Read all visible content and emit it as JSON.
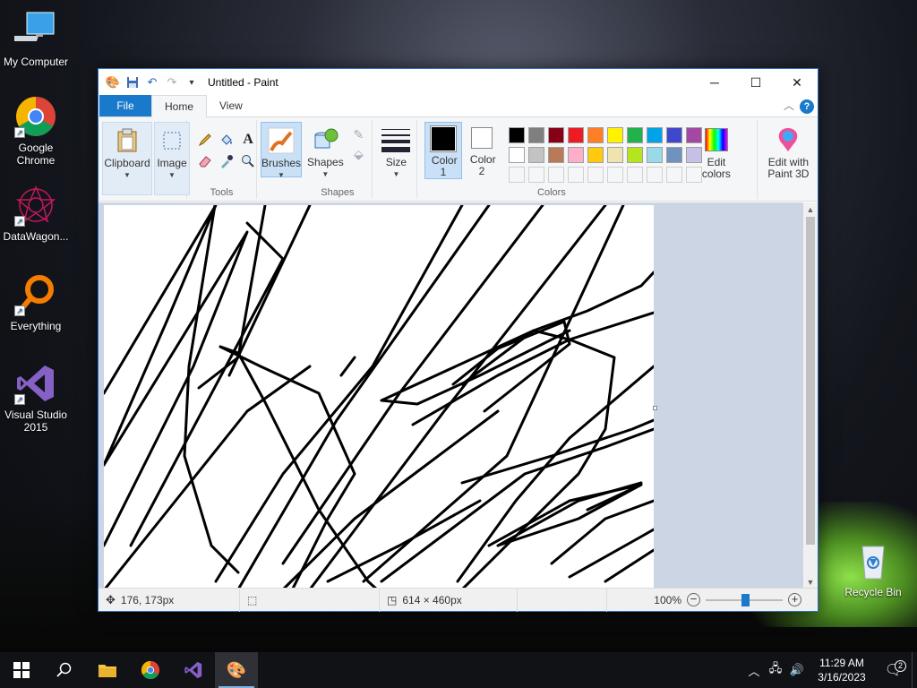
{
  "desktop": {
    "icons": [
      {
        "label": "My Computer"
      },
      {
        "label": "Google Chrome"
      },
      {
        "label": "DataWagon..."
      },
      {
        "label": "Everything"
      },
      {
        "label": "Visual Studio 2015"
      },
      {
        "label": "Recycle Bin"
      }
    ]
  },
  "window": {
    "title": "Untitled - Paint",
    "tabs": [
      "File",
      "Home",
      "View"
    ],
    "help": "?"
  },
  "ribbon": {
    "clipboard": "Clipboard",
    "image": "Image",
    "tools_group": "Tools",
    "brushes": "Brushes",
    "shapes_btn": "Shapes",
    "shapes_group": "Shapes",
    "size": "Size",
    "color1": "Color 1",
    "color2": "Color 2",
    "colors_group": "Colors",
    "edit_colors": "Edit colors",
    "edit_paint3d": "Edit with Paint 3D",
    "text_tool_glyph": "A",
    "palette_row1": [
      "#000000",
      "#7f7f7f",
      "#880015",
      "#ed1c24",
      "#ff7f27",
      "#fff200",
      "#22b14c",
      "#00a2e8",
      "#3f48cc",
      "#a349a4"
    ],
    "palette_row2": [
      "#ffffff",
      "#c3c3c3",
      "#b97a57",
      "#ffaec9",
      "#ffc90e",
      "#efe4b0",
      "#b5e61d",
      "#99d9ea",
      "#7092be",
      "#c8bfe7"
    ],
    "color1_value": "#000000",
    "color2_value": "#ffffff"
  },
  "status": {
    "cursor": "176, 173px",
    "image_size": "614 × 460px",
    "zoom": "100%",
    "zoom_minus": "−",
    "zoom_plus": "+"
  },
  "taskbar": {
    "time": "11:29 AM",
    "date": "3/16/2023",
    "notifications": "2"
  }
}
